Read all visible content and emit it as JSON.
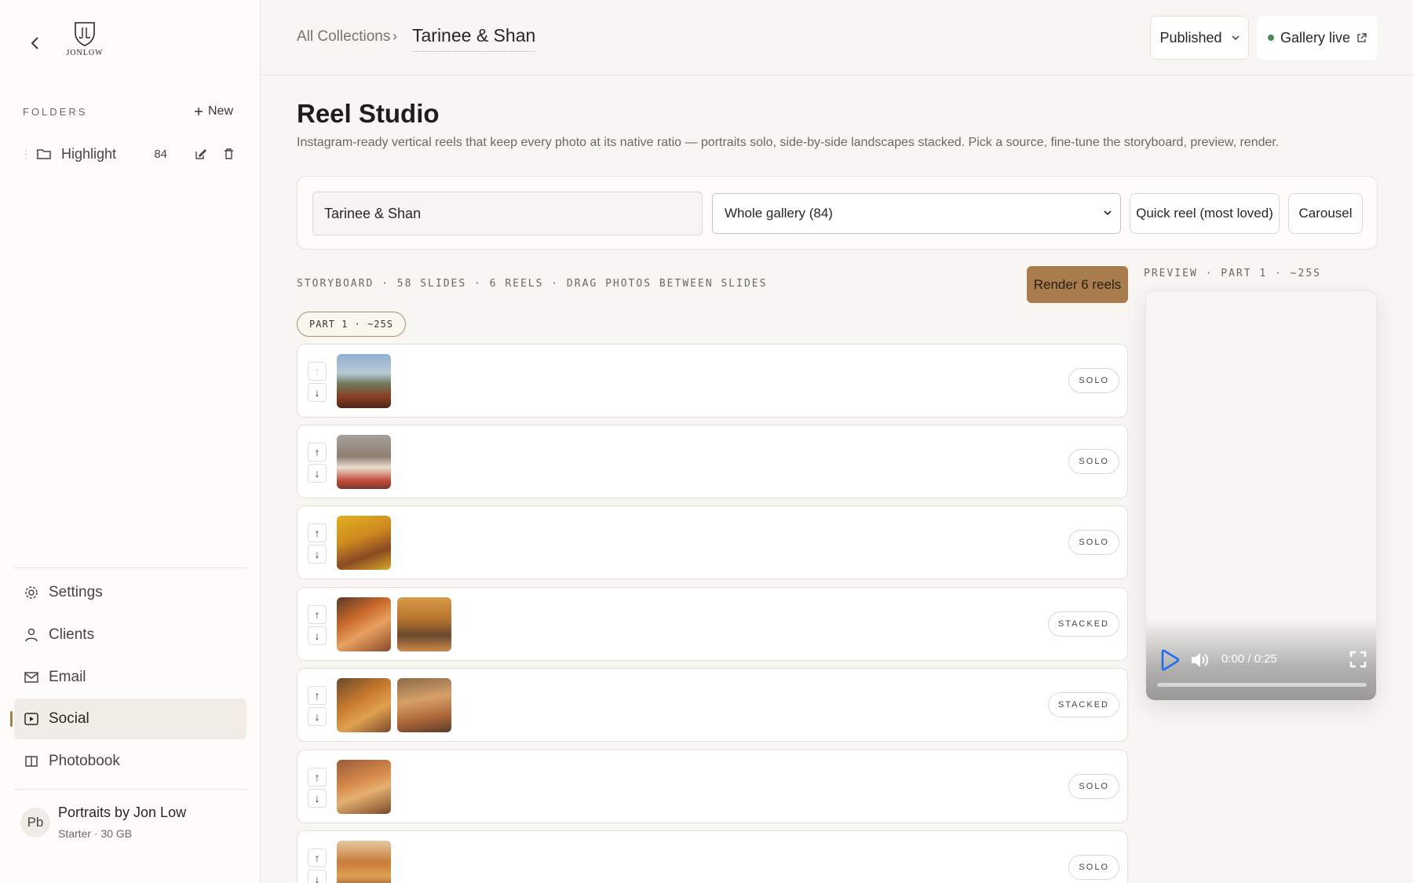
{
  "sidebar": {
    "logo_text": "JONLOW",
    "folders_label": "FOLDERS",
    "new_label": "New",
    "folders": [
      {
        "name": "Highlight",
        "count": "84"
      }
    ],
    "nav": [
      {
        "label": "Settings",
        "icon": "gear-icon"
      },
      {
        "label": "Clients",
        "icon": "user-icon"
      },
      {
        "label": "Email",
        "icon": "mail-icon"
      },
      {
        "label": "Social",
        "icon": "play-square-icon",
        "active": true
      },
      {
        "label": "Photobook",
        "icon": "book-icon"
      }
    ],
    "account": {
      "initials": "Pb",
      "name": "Portraits by Jon Low",
      "plan": "Starter · 30 GB"
    }
  },
  "topbar": {
    "breadcrumb_root": "All Collections",
    "breadcrumb_current": "Tarinee & Shan",
    "status": "Published",
    "gallery_live": "Gallery live"
  },
  "main": {
    "title": "Reel Studio",
    "description": "Instagram-ready vertical reels that keep every photo at its native ratio — portraits solo, side-by-side landscapes stacked. Pick a source, fine-tune the storyboard, preview, render.",
    "source": {
      "name_value": "Tarinee & Shan",
      "scope_selected": "Whole gallery (84)",
      "quick_reel": "Quick reel (most loved)",
      "carousel": "Carousel"
    },
    "storyboard_label": "STORYBOARD · 58 SLIDES · 6 REELS · DRAG PHOTOS BETWEEN SLIDES",
    "render_button": "Render 6 reels",
    "part_chip": "PART 1 · ~25S",
    "slides": [
      {
        "layout": "SOLO",
        "photos": 1
      },
      {
        "layout": "SOLO",
        "photos": 1
      },
      {
        "layout": "SOLO",
        "photos": 1
      },
      {
        "layout": "STACKED",
        "photos": 2
      },
      {
        "layout": "STACKED",
        "photos": 2
      },
      {
        "layout": "SOLO",
        "photos": 1
      },
      {
        "layout": "SOLO",
        "photos": 1
      }
    ],
    "preview": {
      "label": "PREVIEW · PART 1 · ~25S",
      "time": "0:00 / 0:25",
      "progress": 0
    }
  },
  "colors": {
    "accent": "#a97c4e",
    "live": "#4f8a5b",
    "background": "#f7f6f3"
  }
}
